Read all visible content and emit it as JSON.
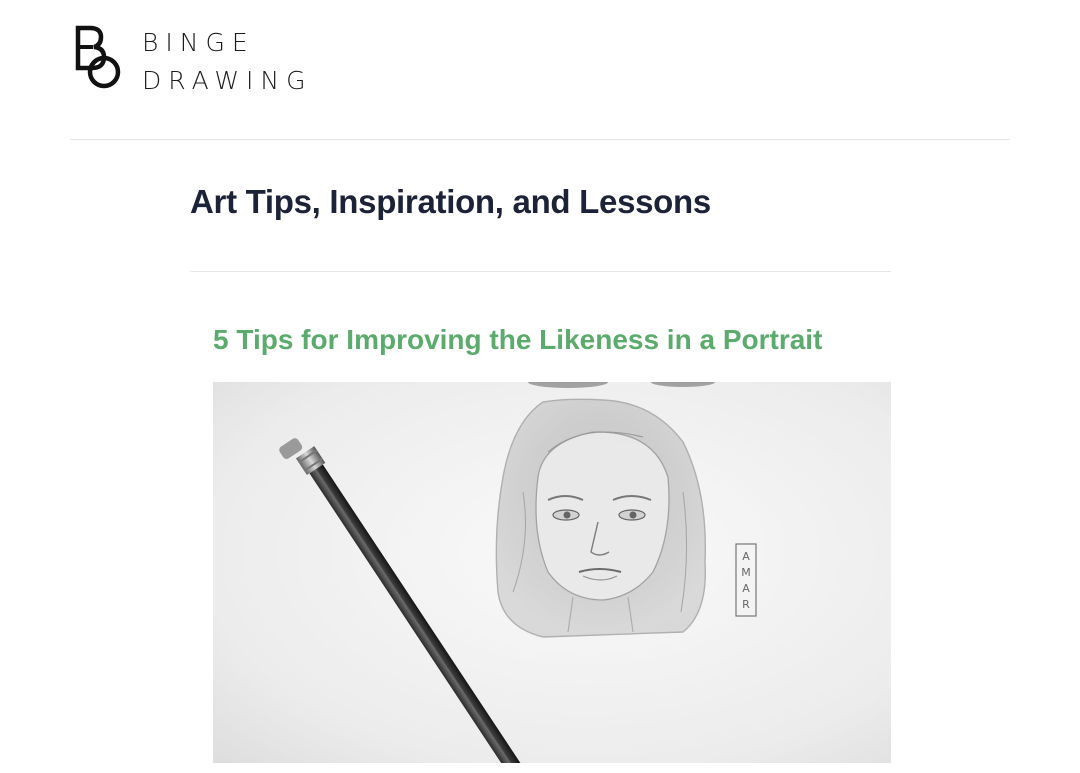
{
  "site": {
    "logo_mark_letters": "BO",
    "name_line1": "BINGE",
    "name_line2": "DRAWING"
  },
  "archive": {
    "title": "Art Tips, Inspiration, and Lessons"
  },
  "posts": [
    {
      "title": "5 Tips for Improving the Likeness in a Portrait",
      "image": {
        "description_icon": "pencil-portrait-sketch-image",
        "signature_box_text": "AMAR"
      }
    }
  ],
  "colors": {
    "heading": "#1c2237",
    "post_title": "#5aab6c",
    "rule": "#e4e4e4"
  }
}
